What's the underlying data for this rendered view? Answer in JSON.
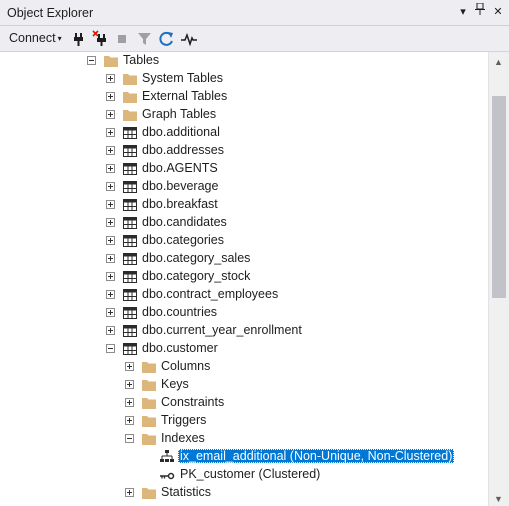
{
  "window": {
    "title": "Object Explorer",
    "pin_glyph": "⊥",
    "close_glyph": "✕",
    "dropdown_glyph": "▾"
  },
  "toolbar": {
    "connect_label": "Connect",
    "connect_caret": "▾",
    "icons": [
      "connect-icon",
      "disconnect-icon",
      "stop-icon",
      "filter-icon",
      "refresh-icon",
      "activity-monitor-icon"
    ]
  },
  "tree": {
    "tables": {
      "label": "Tables",
      "state": "expanded",
      "icon": "folder-icon"
    },
    "tables_children": [
      {
        "label": "System Tables",
        "state": "collapsed",
        "icon": "folder-icon"
      },
      {
        "label": "External Tables",
        "state": "collapsed",
        "icon": "folder-icon"
      },
      {
        "label": "Graph Tables",
        "state": "collapsed",
        "icon": "folder-icon"
      },
      {
        "label": "dbo.additional",
        "state": "collapsed",
        "icon": "table-icon"
      },
      {
        "label": "dbo.addresses",
        "state": "collapsed",
        "icon": "table-icon"
      },
      {
        "label": "dbo.AGENTS",
        "state": "collapsed",
        "icon": "table-icon"
      },
      {
        "label": "dbo.beverage",
        "state": "collapsed",
        "icon": "table-icon"
      },
      {
        "label": "dbo.breakfast",
        "state": "collapsed",
        "icon": "table-icon"
      },
      {
        "label": "dbo.candidates",
        "state": "collapsed",
        "icon": "table-icon"
      },
      {
        "label": "dbo.categories",
        "state": "collapsed",
        "icon": "table-icon"
      },
      {
        "label": "dbo.category_sales",
        "state": "collapsed",
        "icon": "table-icon"
      },
      {
        "label": "dbo.category_stock",
        "state": "collapsed",
        "icon": "table-icon"
      },
      {
        "label": "dbo.contract_employees",
        "state": "collapsed",
        "icon": "table-icon"
      },
      {
        "label": "dbo.countries",
        "state": "collapsed",
        "icon": "table-icon"
      },
      {
        "label": "dbo.current_year_enrollment",
        "state": "collapsed",
        "icon": "table-icon"
      },
      {
        "label": "dbo.customer",
        "state": "expanded",
        "icon": "table-icon"
      }
    ],
    "customer_children": [
      {
        "label": "Columns",
        "state": "collapsed",
        "icon": "folder-icon"
      },
      {
        "label": "Keys",
        "state": "collapsed",
        "icon": "folder-icon"
      },
      {
        "label": "Constraints",
        "state": "collapsed",
        "icon": "folder-icon"
      },
      {
        "label": "Triggers",
        "state": "collapsed",
        "icon": "folder-icon"
      },
      {
        "label": "Indexes",
        "state": "expanded",
        "icon": "folder-icon"
      }
    ],
    "indexes_children": [
      {
        "label": "ix_email_additional (Non-Unique, Non-Clustered)",
        "icon": "nonclustered-index-icon",
        "selected": true
      },
      {
        "label": "PK_customer (Clustered)",
        "icon": "primary-key-icon",
        "selected": false
      }
    ],
    "after_indexes": {
      "label": "Statistics",
      "state": "collapsed",
      "icon": "folder-icon"
    }
  },
  "colors": {
    "selection": "#0078d7",
    "folder": "#dcb67a",
    "chrome": "#eeeef2"
  }
}
